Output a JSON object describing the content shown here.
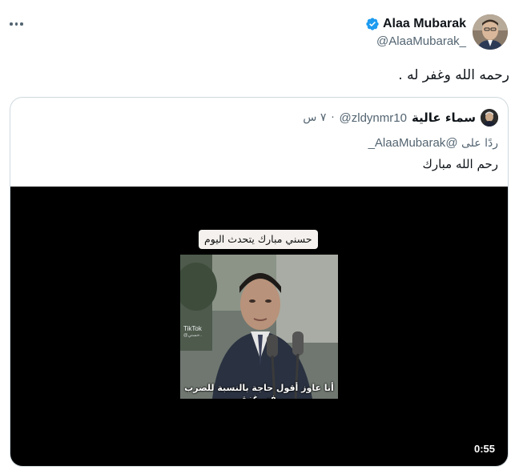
{
  "tweet": {
    "author_name": "Alaa Mubarak",
    "author_handle": "@AlaaMubarak_",
    "text": "رحمه الله وغفر له .",
    "verified": true,
    "verified_color": "#1d9bf0"
  },
  "quote": {
    "author_name": "سماء عالية",
    "author_handle": "@zldynmr10",
    "separator": "·",
    "time": "٧ س",
    "reply_prefix": "ردًا على",
    "reply_mention": "@AlaaMubarak_",
    "text": "رحم الله مبارك",
    "video": {
      "title": "حسني مبارك يتحدث اليوم",
      "caption": "أنا عاوز أقول حاجة بالنسبة للضرب في غزة",
      "watermark": "TikTok",
      "watermark_sub": "@حسني..",
      "duration": "0:55"
    }
  },
  "icons": {
    "more": "more-horizontal-icon",
    "verified": "verified-badge-icon"
  }
}
